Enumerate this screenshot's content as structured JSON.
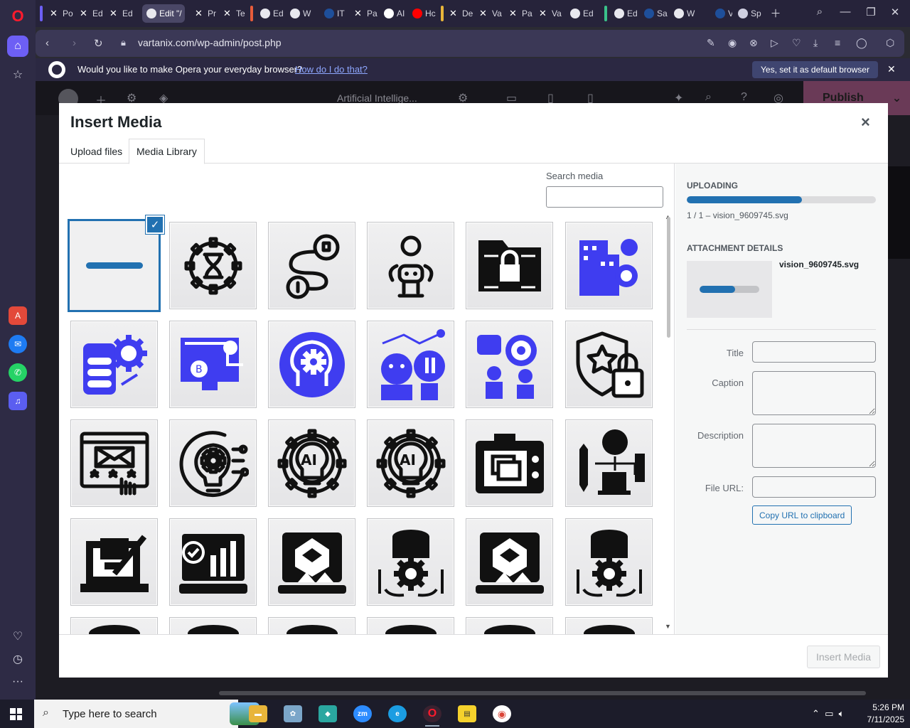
{
  "tabs": [
    {
      "label": "Po",
      "icon": "x-icon"
    },
    {
      "label": "Ed",
      "icon": "x-icon"
    },
    {
      "label": "Ed",
      "icon": "x-icon"
    },
    {
      "label": "Edit \"/",
      "icon": "globe-icon"
    },
    {
      "label": "Pr",
      "icon": "x-icon"
    },
    {
      "label": "Te",
      "icon": "x-icon"
    },
    {
      "label": "Ed",
      "icon": "globe-icon"
    },
    {
      "label": "W",
      "icon": "globe-icon"
    },
    {
      "label": "IT",
      "icon": "doc-icon"
    },
    {
      "label": "Pa",
      "icon": "x-icon"
    },
    {
      "label": "AI",
      "icon": "google-icon"
    },
    {
      "label": "Hc",
      "icon": "youtube-icon"
    },
    {
      "label": "De",
      "icon": "x-icon"
    },
    {
      "label": "Va",
      "icon": "x-icon"
    },
    {
      "label": "Pa",
      "icon": "x-icon"
    },
    {
      "label": "Va",
      "icon": "x-icon"
    },
    {
      "label": "Ed",
      "icon": "globe-icon"
    },
    {
      "label": "Ed",
      "icon": "globe-icon"
    },
    {
      "label": "Sa",
      "icon": "doc-icon"
    },
    {
      "label": "W",
      "icon": "globe-icon"
    },
    {
      "label": "Va",
      "icon": "doc-icon"
    },
    {
      "label": "Sp",
      "icon": "grid-icon"
    }
  ],
  "address": {
    "url": "vartanix.com/wp-admin/post.php"
  },
  "infobar": {
    "message": "Would you like to make Opera your everyday browser?",
    "link": "How do I do that?",
    "button": "Yes, set it as default browser"
  },
  "editor": {
    "title": "Artificial Intellige...",
    "publish": "Publish"
  },
  "modal": {
    "title": "Insert Media",
    "close": "×",
    "tabs": {
      "upload": "Upload files",
      "library": "Media Library"
    },
    "search_label": "Search media",
    "insert_button": "Insert Media"
  },
  "upload": {
    "heading": "UPLOADING",
    "progress_fraction": 0.61,
    "status": "1 / 1  –  vision_9609745.svg"
  },
  "attachment": {
    "heading": "ATTACHMENT DETAILS",
    "filename": "vision_9609745.svg",
    "preview_fraction": 0.6,
    "fields": {
      "title": "Title",
      "caption": "Caption",
      "description": "Description",
      "file_url": "File URL:"
    },
    "copy_button": "Copy URL to clipboard"
  },
  "colors": {
    "accent": "#2271b1",
    "icon_blue": "#3f3df0",
    "icon_black": "#111111"
  },
  "thumbnails": [
    {
      "icon": "upload-placeholder-icon",
      "style": "placeholder",
      "selected": true
    },
    {
      "icon": "gear-hourglass-icon",
      "style": "outline"
    },
    {
      "icon": "strategy-path-icon",
      "style": "outline"
    },
    {
      "icon": "robot-idea-icon",
      "style": "outline"
    },
    {
      "icon": "secure-folder-icon",
      "style": "black"
    },
    {
      "icon": "smart-building-icon",
      "style": "blue"
    },
    {
      "icon": "database-gear-icon",
      "style": "blue"
    },
    {
      "icon": "bitcoin-screen-icon",
      "style": "blue"
    },
    {
      "icon": "head-gears-icon",
      "style": "blue"
    },
    {
      "icon": "ai-chart-robot-icon",
      "style": "blue"
    },
    {
      "icon": "business-target-icon",
      "style": "blue"
    },
    {
      "icon": "shield-lock-icon",
      "style": "outline"
    },
    {
      "icon": "rating-email-icon",
      "style": "outline"
    },
    {
      "icon": "bulb-gear-icon",
      "style": "outline"
    },
    {
      "icon": "ai-bulb-gear-icon",
      "style": "outline"
    },
    {
      "icon": "ai-bulb-gear-icon",
      "style": "outline"
    },
    {
      "icon": "camera-layers-icon",
      "style": "black"
    },
    {
      "icon": "brain-laptop-icon",
      "style": "black"
    },
    {
      "icon": "laptop-edit-icon",
      "style": "black"
    },
    {
      "icon": "laptop-analytics-icon",
      "style": "black"
    },
    {
      "icon": "laptop-upload-icon",
      "style": "black"
    },
    {
      "icon": "database-cycle-icon",
      "style": "black"
    },
    {
      "icon": "laptop-upload-icon",
      "style": "black"
    },
    {
      "icon": "database-cycle-icon",
      "style": "black"
    },
    {
      "icon": "partial-icon",
      "style": "black"
    },
    {
      "icon": "partial-icon",
      "style": "black"
    },
    {
      "icon": "partial-icon",
      "style": "black"
    },
    {
      "icon": "partial-icon",
      "style": "black"
    },
    {
      "icon": "partial-icon",
      "style": "black"
    },
    {
      "icon": "partial-icon",
      "style": "black"
    }
  ],
  "taskbar": {
    "search_placeholder": "Type here to search",
    "time": "5:26 PM",
    "date": "7/11/2025"
  }
}
